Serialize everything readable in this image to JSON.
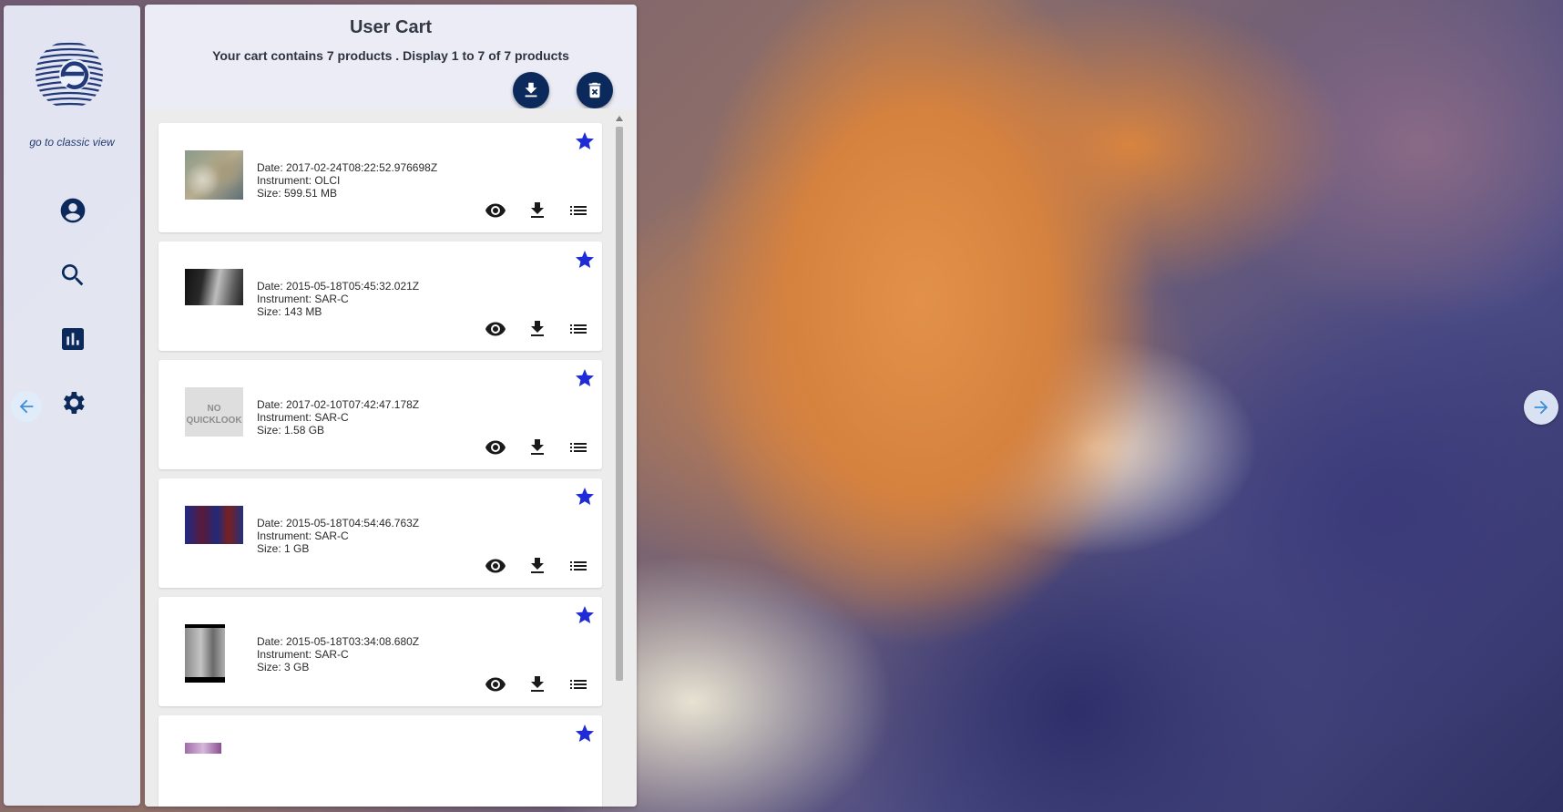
{
  "sidebar": {
    "classic_link": "go to classic view",
    "icons": [
      "account-icon",
      "search-icon",
      "chart-icon",
      "settings-icon"
    ]
  },
  "cart": {
    "title": "User Cart",
    "subtitle": "Your cart contains 7 products . Display 1 to 7 of 7 products",
    "actions": [
      "download-all-icon",
      "delete-cart-icon"
    ],
    "colors": {
      "button_bg": "#0b2a5b",
      "star": "#1f2bd6"
    }
  },
  "products": [
    {
      "date": "Date: 2017-02-24T08:22:52.976698Z",
      "instrument": "Instrument: OLCI",
      "size": "Size: 599.51 MB",
      "quicklook": "image"
    },
    {
      "date": "Date: 2015-05-18T05:45:32.021Z",
      "instrument": "Instrument: SAR-C",
      "size": "Size: 143 MB",
      "quicklook": "image"
    },
    {
      "date": "Date: 2017-02-10T07:42:47.178Z",
      "instrument": "Instrument: SAR-C",
      "size": "Size: 1.58 GB",
      "quicklook": "none",
      "no_quicklook_text_1": "NO",
      "no_quicklook_text_2": "QUICKLOOK"
    },
    {
      "date": "Date: 2015-05-18T04:54:46.763Z",
      "instrument": "Instrument: SAR-C",
      "size": "Size: 1 GB",
      "quicklook": "image"
    },
    {
      "date": "Date: 2015-05-18T03:34:08.680Z",
      "instrument": "Instrument: SAR-C",
      "size": "Size: 3 GB",
      "quicklook": "image"
    }
  ]
}
